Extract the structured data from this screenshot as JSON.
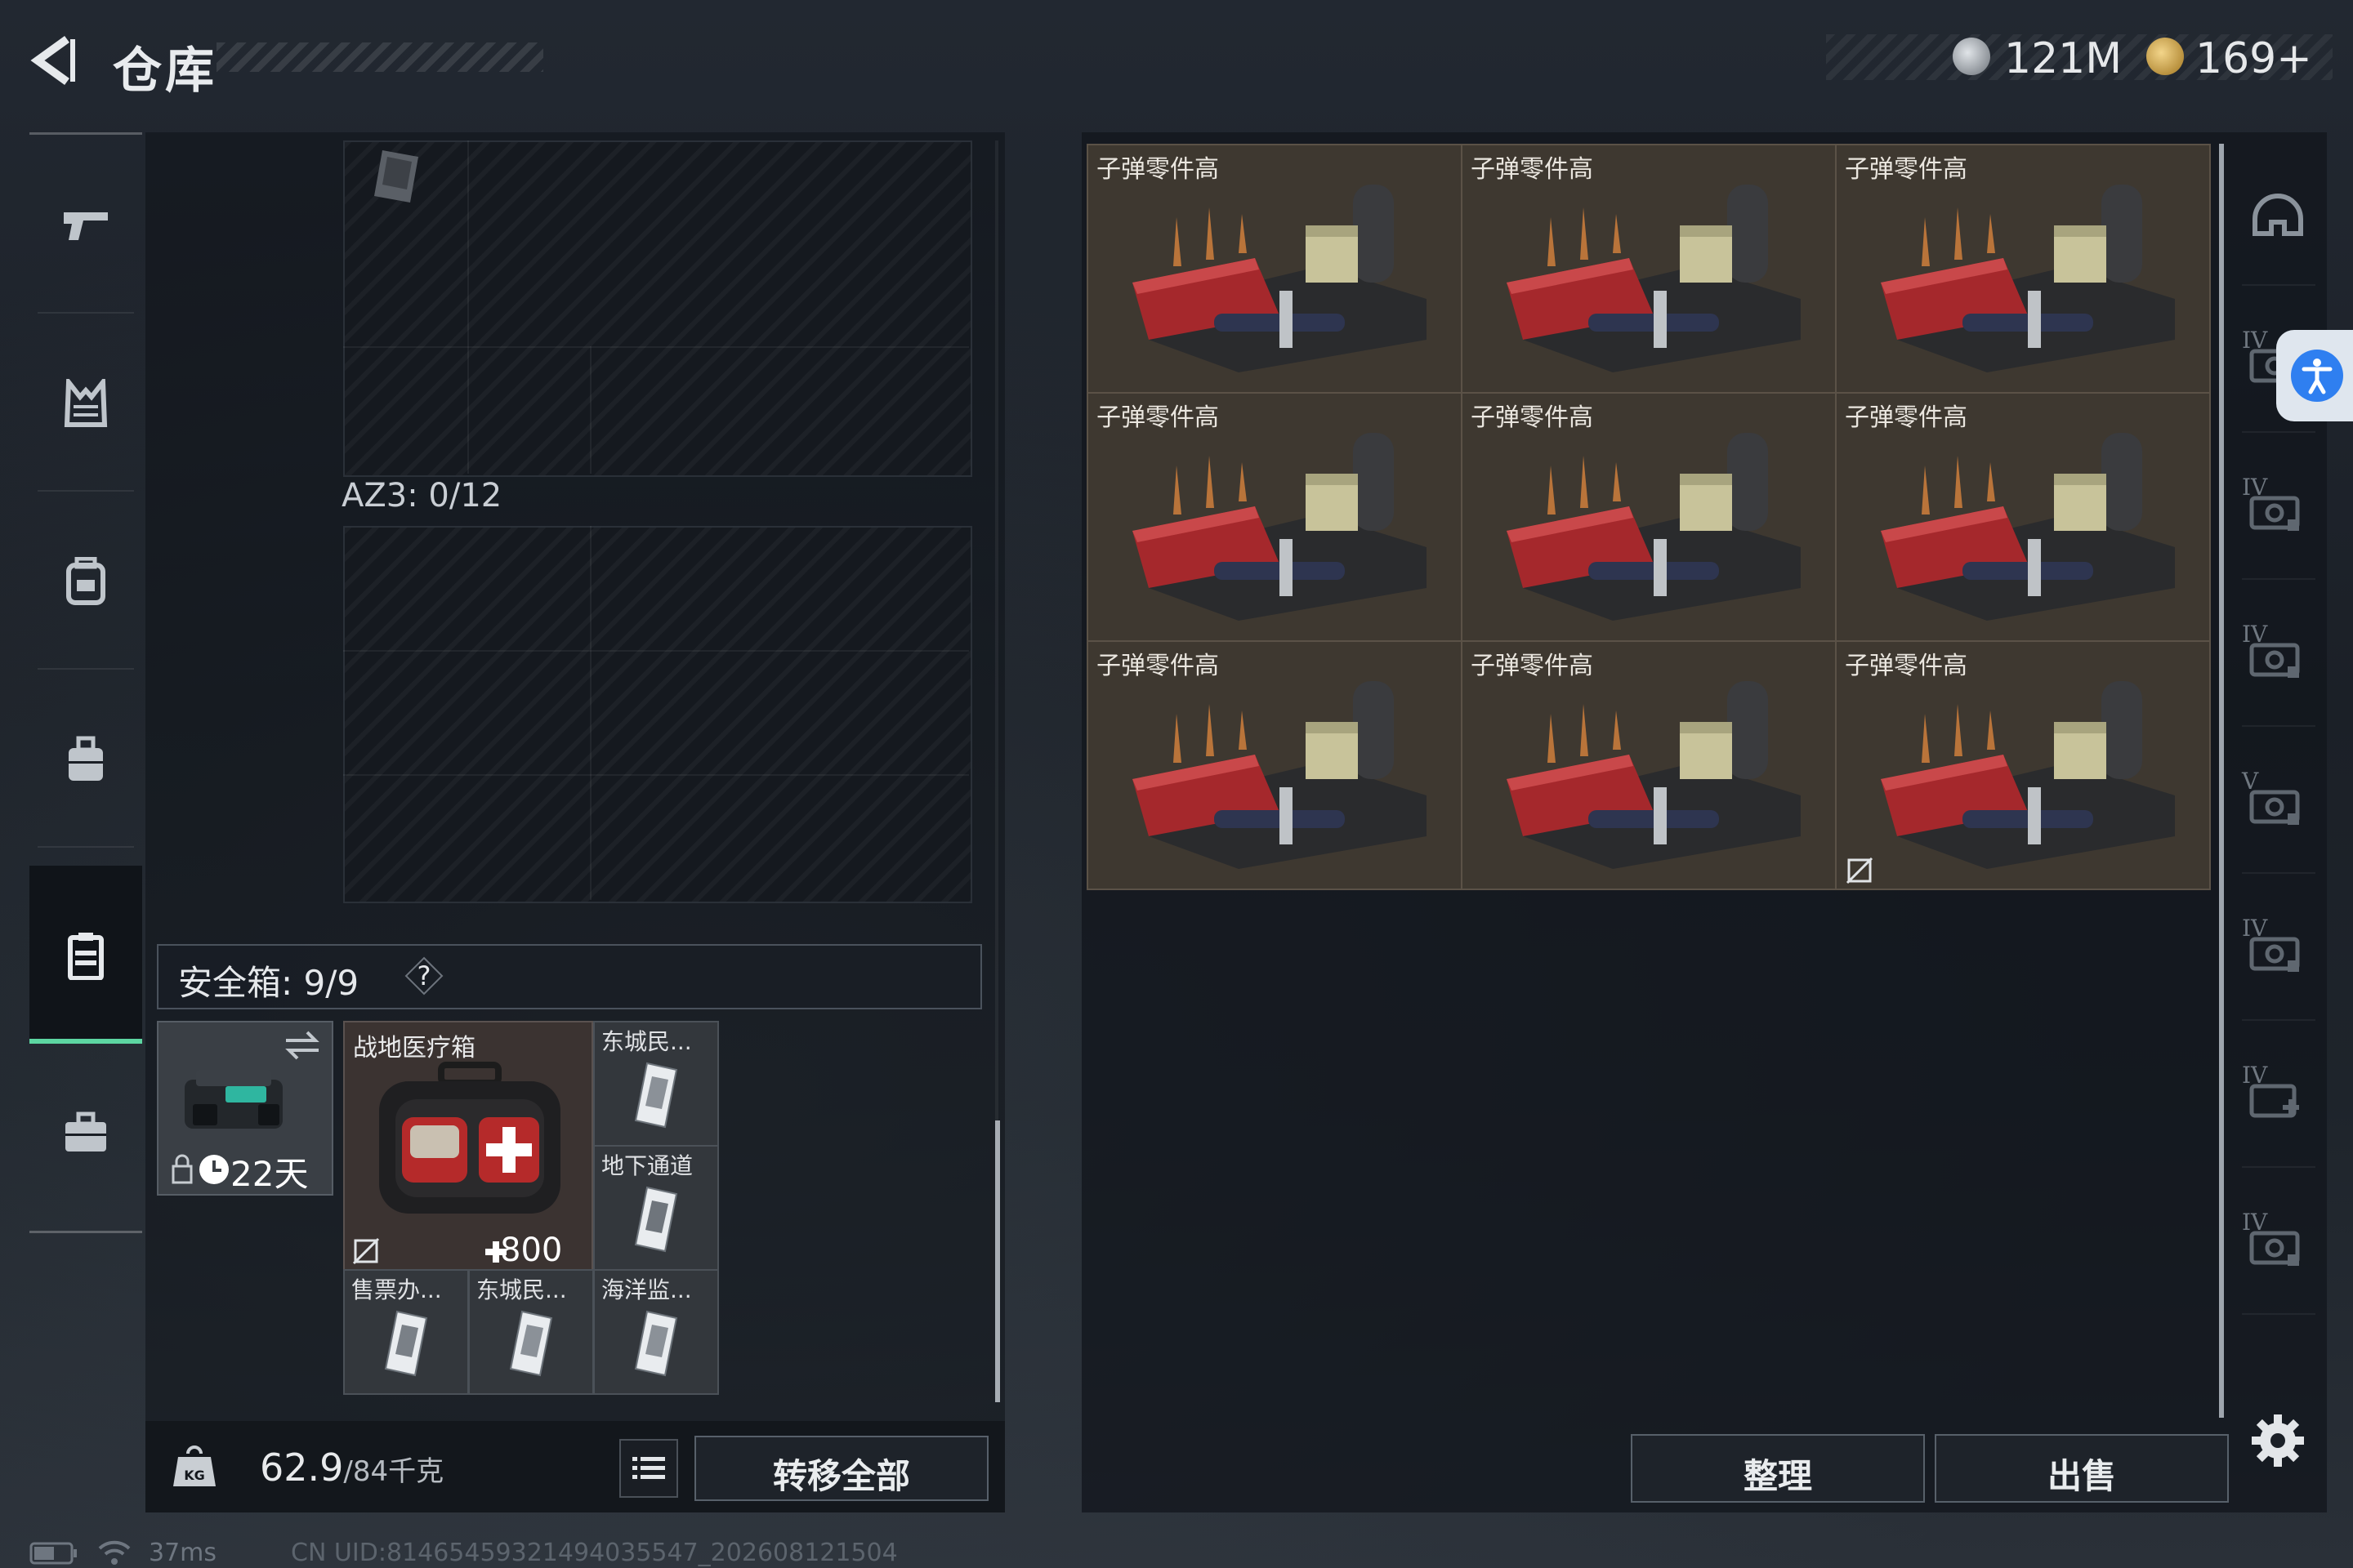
{
  "header": {
    "title": "仓库",
    "currency_coins": "121M",
    "currency_gold": "169+"
  },
  "nav": {
    "items": [
      {
        "icon": "pistol-icon"
      },
      {
        "icon": "vest-icon"
      },
      {
        "icon": "backpack-icon"
      },
      {
        "icon": "bag-icon"
      },
      {
        "icon": "container-icon",
        "active": true
      },
      {
        "icon": "briefcase-icon"
      }
    ]
  },
  "loadout": {
    "az3_label": "AZ3: 0/12",
    "safe_box_label": "安全箱: 9/9",
    "safe_box_help": "?",
    "case_days": "22天",
    "medkit": {
      "name": "战地医疗箱",
      "value": "800"
    },
    "keys": [
      {
        "name": "东城民..."
      },
      {
        "name": "地下通道"
      },
      {
        "name": "售票办..."
      },
      {
        "name": "东城民..."
      },
      {
        "name": "海洋监..."
      }
    ]
  },
  "bottom_left": {
    "weight_current": "62.9",
    "weight_max": "/84千克",
    "transfer_all": "转移全部"
  },
  "stash": {
    "items": [
      {
        "name": "子弹零件高"
      },
      {
        "name": "子弹零件高"
      },
      {
        "name": "子弹零件高"
      },
      {
        "name": "子弹零件高"
      },
      {
        "name": "子弹零件高"
      },
      {
        "name": "子弹零件高"
      },
      {
        "name": "子弹零件高"
      },
      {
        "name": "子弹零件高"
      },
      {
        "name": "子弹零件高"
      }
    ],
    "sort_label": "整理",
    "sell_label": "出售"
  },
  "rail": {
    "items": [
      {
        "tier": "",
        "icon": "helmet-icon"
      },
      {
        "tier": "IV",
        "icon": "ammo-parts-icon"
      },
      {
        "tier": "IV",
        "icon": "tools-icon"
      },
      {
        "tier": "IV",
        "icon": "electronics-icon"
      },
      {
        "tier": "V",
        "icon": "electronics-icon"
      },
      {
        "tier": "IV",
        "icon": "parts-icon"
      },
      {
        "tier": "IV",
        "icon": "medical-icon"
      },
      {
        "tier": "IV",
        "icon": "misc-icon"
      }
    ]
  },
  "status": {
    "ping": "37ms",
    "uid": "CN UID:8146545932149403554​7_202608121504"
  },
  "colors": {
    "accent_green": "#5dd6a2",
    "access_blue": "#2f7ff0"
  }
}
